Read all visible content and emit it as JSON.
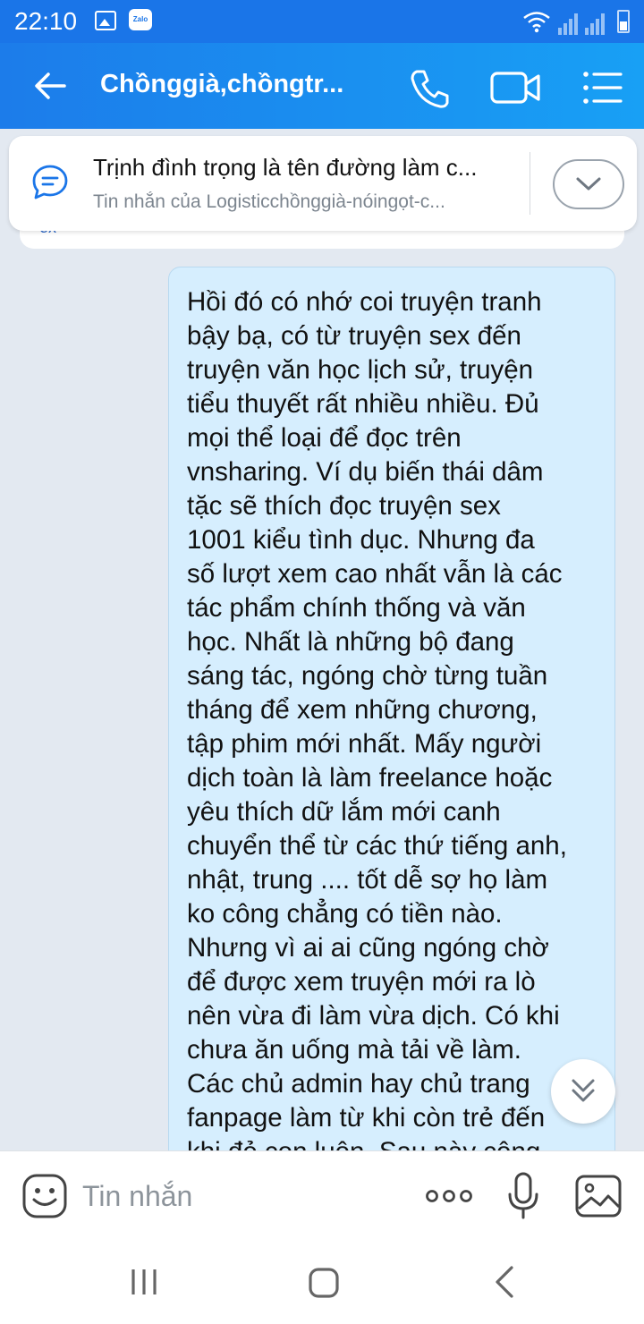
{
  "status_bar": {
    "time": "22:10",
    "icons": [
      "gallery-icon",
      "zalo-icon",
      "wifi-icon",
      "signal-icon",
      "signal-icon",
      "battery-icon"
    ],
    "zalo_badge": "Zalo"
  },
  "header": {
    "title": "Chồnggià,chồngtr...",
    "icons": [
      "back-arrow-icon",
      "phone-icon",
      "video-camera-icon",
      "list-menu-icon"
    ],
    "color": "#1c7cea"
  },
  "pinned_message": {
    "icon": "chat-bubble-icon",
    "title": "Trịnh đình trọng là tên đường làm c...",
    "subtitle": "Tin nhắn của Logisticchồnggià-nóingọt-c...",
    "expand_icon": "chevron-down-icon"
  },
  "previous_message": {
    "peek_text": "ex"
  },
  "message": {
    "text": "Hồi đó có nhớ coi truyện tranh\nbậy bạ, có từ truyện sex đến\ntruyện văn học lịch sử, truyện\ntiểu thuyết rất nhiều nhiều. Đủ\nmọi thể loại để đọc trên\nvnsharing. Ví dụ biến thái dâm\ntặc sẽ thích đọc truyện sex\n1001 kiểu tình dục. Nhưng đa\nsố lượt xem cao nhất vẫn là các\ntác phẩm chính thống và văn\nhọc. Nhất là những bộ đang\nsáng tác, ngóng chờ từng tuần\ntháng để xem những chương,\ntập phim mới nhất. Mấy người\ndịch toàn là làm freelance hoặc\nyêu thích dữ lắm mới canh\nchuyển thể từ các thứ tiếng anh,\nnhật, trung .... tốt dễ sợ họ làm\nko công chẳng có tiền nào.\nNhưng vì ai ai cũng ngóng chờ\nđể được xem truyện mới ra lò\nnên vừa đi làm vừa dịch. Có khi\nchưa ăn uống mà tải về làm.\nCác chủ admin hay chủ trang\nfanpage làm từ khi còn trẻ đến\nkhi đẻ con luôn. Sau này công",
    "bubble_color": "#d6eefe"
  },
  "scroll_button": {
    "icon": "double-chevron-down-icon"
  },
  "composer": {
    "placeholder": "Tin nhắn",
    "icons": [
      "emoji-icon",
      "more-dots-icon",
      "microphone-icon",
      "image-icon"
    ]
  },
  "nav_bar": {
    "icons": [
      "recents-icon",
      "home-icon",
      "back-icon"
    ]
  }
}
